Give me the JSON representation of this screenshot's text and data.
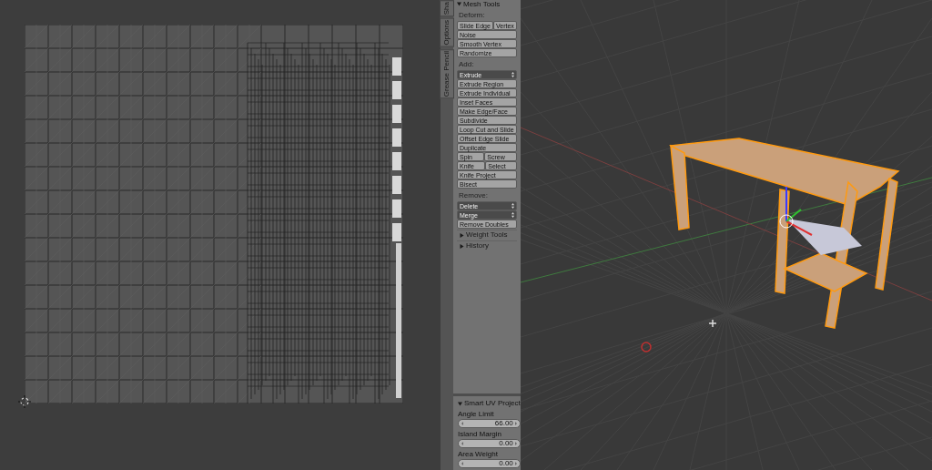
{
  "tool_tabs": [
    {
      "label": "Sha",
      "selected": false
    },
    {
      "label": "Options",
      "selected": false
    },
    {
      "label": "Grease Pencil",
      "selected": false
    }
  ],
  "mesh_tools": {
    "title": "Mesh Tools",
    "expanded": true,
    "sections": [
      {
        "label": "Deform:",
        "rows": [
          {
            "kind": "pair",
            "buttons": [
              "Slide Edge",
              "Vertex"
            ]
          },
          {
            "kind": "button",
            "buttons": [
              "Noise"
            ]
          },
          {
            "kind": "button",
            "buttons": [
              "Smooth Vertex"
            ]
          },
          {
            "kind": "button",
            "buttons": [
              "Randomize"
            ]
          }
        ]
      },
      {
        "label": "Add:",
        "rows": [
          {
            "kind": "dropdown",
            "buttons": [
              "Extrude"
            ]
          },
          {
            "kind": "button",
            "buttons": [
              "Extrude Region"
            ]
          },
          {
            "kind": "button",
            "buttons": [
              "Extrude Individual"
            ]
          },
          {
            "kind": "button",
            "buttons": [
              "Inset Faces"
            ]
          },
          {
            "kind": "button",
            "buttons": [
              "Make Edge/Face"
            ]
          },
          {
            "kind": "button",
            "buttons": [
              "Subdivide"
            ]
          },
          {
            "kind": "button",
            "buttons": [
              "Loop Cut and Slide"
            ]
          },
          {
            "kind": "button",
            "buttons": [
              "Offset Edge Slide"
            ]
          },
          {
            "kind": "button",
            "buttons": [
              "Duplicate"
            ]
          },
          {
            "kind": "pair",
            "buttons": [
              "Spin",
              "Screw"
            ]
          },
          {
            "kind": "pair",
            "buttons": [
              "Knife",
              "Select"
            ]
          },
          {
            "kind": "button",
            "buttons": [
              "Knife Project"
            ]
          },
          {
            "kind": "button",
            "buttons": [
              "Bisect"
            ]
          }
        ]
      },
      {
        "label": "Remove:",
        "rows": [
          {
            "kind": "dropdown",
            "buttons": [
              "Delete"
            ]
          },
          {
            "kind": "dropdown",
            "buttons": [
              "Merge"
            ]
          },
          {
            "kind": "button",
            "buttons": [
              "Remove Doubles"
            ]
          }
        ]
      }
    ]
  },
  "collapsed_panels": [
    {
      "title": "Weight Tools",
      "expanded": false
    },
    {
      "title": "History",
      "expanded": false
    }
  ],
  "operator_panel": {
    "title": "Smart UV Project",
    "expanded": true,
    "fields": [
      {
        "label": "Angle Limit",
        "value": "66.00"
      },
      {
        "label": "Island Margin",
        "value": "0.00"
      },
      {
        "label": "Area Weight",
        "value": "0.00"
      }
    ]
  }
}
